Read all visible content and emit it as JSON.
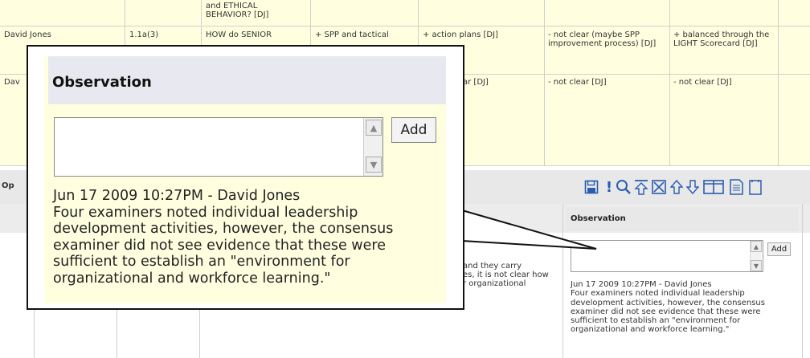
{
  "table": {
    "top_row_question": "and ETHICAL\nBEHAVIOR? [DJ]",
    "rows": [
      {
        "examiner": "David Jones",
        "item": "1.1a(3)",
        "question": "HOW do SENIOR",
        "strength": "+ SPP and tactical",
        "plans": "+ action plans [DJ]",
        "clear": "- not clear (maybe SPP improvement process) [DJ]",
        "balanced": "+ balanced through the LIGHT Scorecard [DJ]"
      },
      {
        "examiner": "Dav",
        "plans": "ar [DJ]",
        "clear": "- not clear [DJ]",
        "balanced": "- not clear [DJ]"
      }
    ],
    "op_label": "Op",
    "fragment_text": "and they carry\nes, it is not clear how\nr organizational"
  },
  "toolbar": {
    "icons": [
      "save-icon",
      "exclamation-icon",
      "search-icon",
      "collapse-top-icon",
      "close-box-icon",
      "arrow-up-icon",
      "arrow-down-icon",
      "columns-icon",
      "document-icon",
      "page-icon"
    ]
  },
  "observation_panel": {
    "header": "Observation",
    "add_label": "Add",
    "textarea_value": "",
    "note_meta": "Jun 17 2009 10:27PM - David Jones",
    "note_text": "Four examiners noted individual leadership development activities, however, the consensus examiner did not see evidence that these were sufficient to establish an \"environment for organizational and workforce learning.\""
  },
  "colors": {
    "row_yellow": "#ffffe0",
    "header_grey": "#e8e8e8",
    "icon_blue": "#2a5db0",
    "callout_border": "#111111"
  }
}
